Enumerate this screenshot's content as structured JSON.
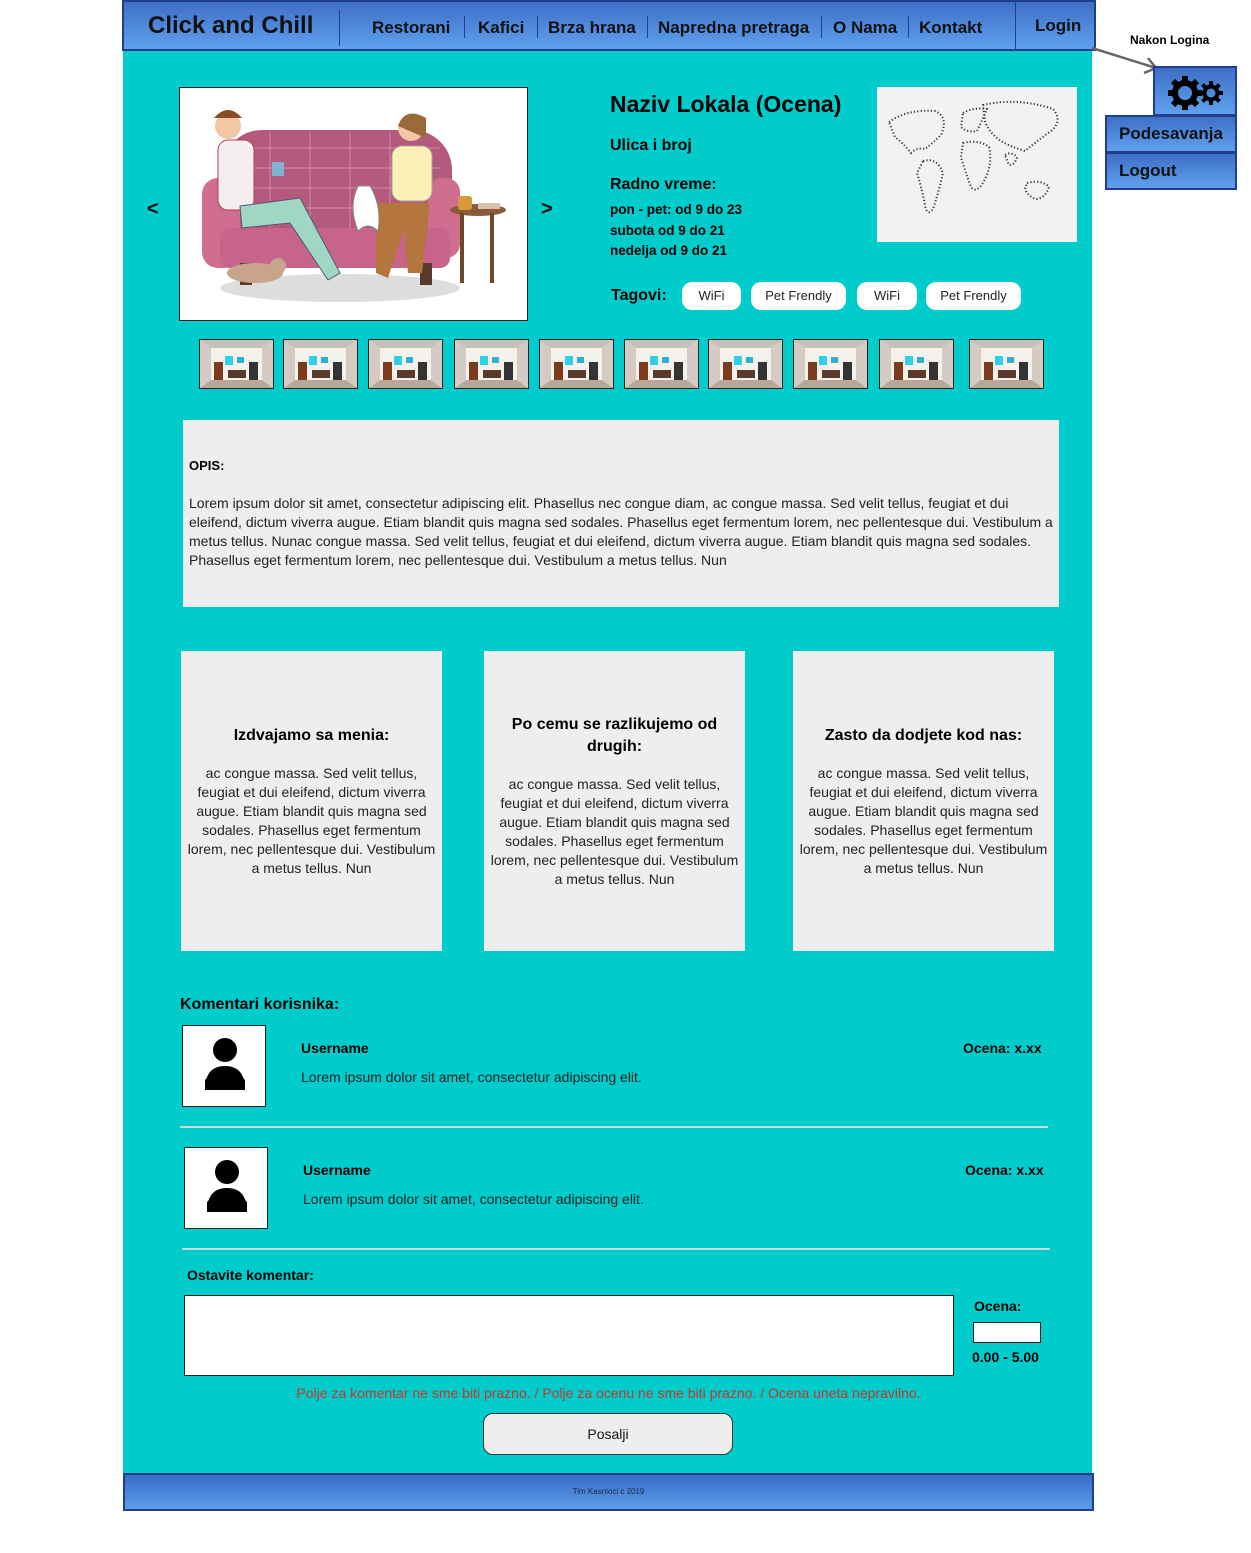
{
  "header": {
    "brand": "Click and Chill",
    "nav": [
      "Restorani",
      "Kafici",
      "Brza hrana",
      "Napredna pretraga",
      "O Nama",
      "Kontakt"
    ],
    "login": "Login"
  },
  "annotation": {
    "after_login": "Nakon Logina",
    "menu": [
      "Podesavanja",
      "Logout"
    ],
    "icon": "gears-icon"
  },
  "slider": {
    "prev": "<",
    "next": ">"
  },
  "venue": {
    "name": "Naziv Lokala (Ocena)",
    "address": "Ulica i broj",
    "hours_title": "Radno vreme:",
    "hours": [
      "pon - pet: od 9 do 23",
      "subota od 9 do 21",
      "nedelja od 9 do 21"
    ],
    "tags_label": "Tagovi:",
    "tags": [
      "WiFi",
      "Pet Frendly",
      "WiFi",
      "Pet Frendly"
    ]
  },
  "description": {
    "title": "OPIS:",
    "text": "Lorem ipsum dolor sit amet, consectetur adipiscing elit. Phasellus nec congue diam, ac congue massa. Sed velit tellus, feugiat et dui eleifend, dictum viverra augue. Etiam blandit quis magna sed sodales. Phasellus eget fermentum lorem, nec pellentesque dui. Vestibulum a metus tellus. Nunac congue massa. Sed velit tellus, feugiat et dui eleifend, dictum viverra augue. Etiam blandit quis magna sed sodales. Phasellus eget fermentum lorem, nec pellentesque dui. Vestibulum a metus tellus. Nun"
  },
  "features": [
    {
      "title": "Izdvajamo sa menia:",
      "text": "ac congue massa. Sed velit tellus, feugiat et dui eleifend, dictum viverra augue. Etiam blandit quis magna sed sodales. Phasellus eget fermentum lorem, nec pellentesque dui. Vestibulum a metus tellus. Nun"
    },
    {
      "title": "Po cemu se razlikujemo od drugih:",
      "text": "ac congue massa. Sed velit tellus, feugiat et dui eleifend, dictum viverra augue. Etiam blandit quis magna sed sodales. Phasellus eget fermentum lorem, nec pellentesque dui. Vestibulum a metus tellus. Nun"
    },
    {
      "title": "Zasto da dodjete kod nas:",
      "text": "ac congue massa. Sed velit tellus, feugiat et dui eleifend, dictum viverra augue. Etiam blandit quis magna sed sodales. Phasellus eget fermentum lorem, nec pellentesque dui. Vestibulum a metus tellus. Nun"
    }
  ],
  "comments": {
    "title": "Komentari korisnika:",
    "items": [
      {
        "username": "Username",
        "rating": "Ocena: x.xx",
        "text": "Lorem ipsum dolor sit amet, consectetur adipiscing elit."
      },
      {
        "username": "Username",
        "rating": "Ocena: x.xx",
        "text": "Lorem ipsum dolor sit amet, consectetur adipiscing elit."
      }
    ]
  },
  "form": {
    "title": "Ostavite komentar:",
    "comment_value": "",
    "rating_label": "Ocena:",
    "rating_value": "",
    "rating_range": "0.00 - 5.00",
    "error": "Polje za komentar ne sme biti prazno. / Polje za ocenu ne sme biti prazno. / Ocena uneta nepravilno.",
    "submit": "Posalji"
  },
  "footer": {
    "text": "Tim Kasnioci  c 2019"
  },
  "colors": {
    "main_bg": "#00cccc",
    "header_blue": "#4a86d8",
    "panel_gray": "#eeeeee",
    "error_red": "#c0392b"
  }
}
